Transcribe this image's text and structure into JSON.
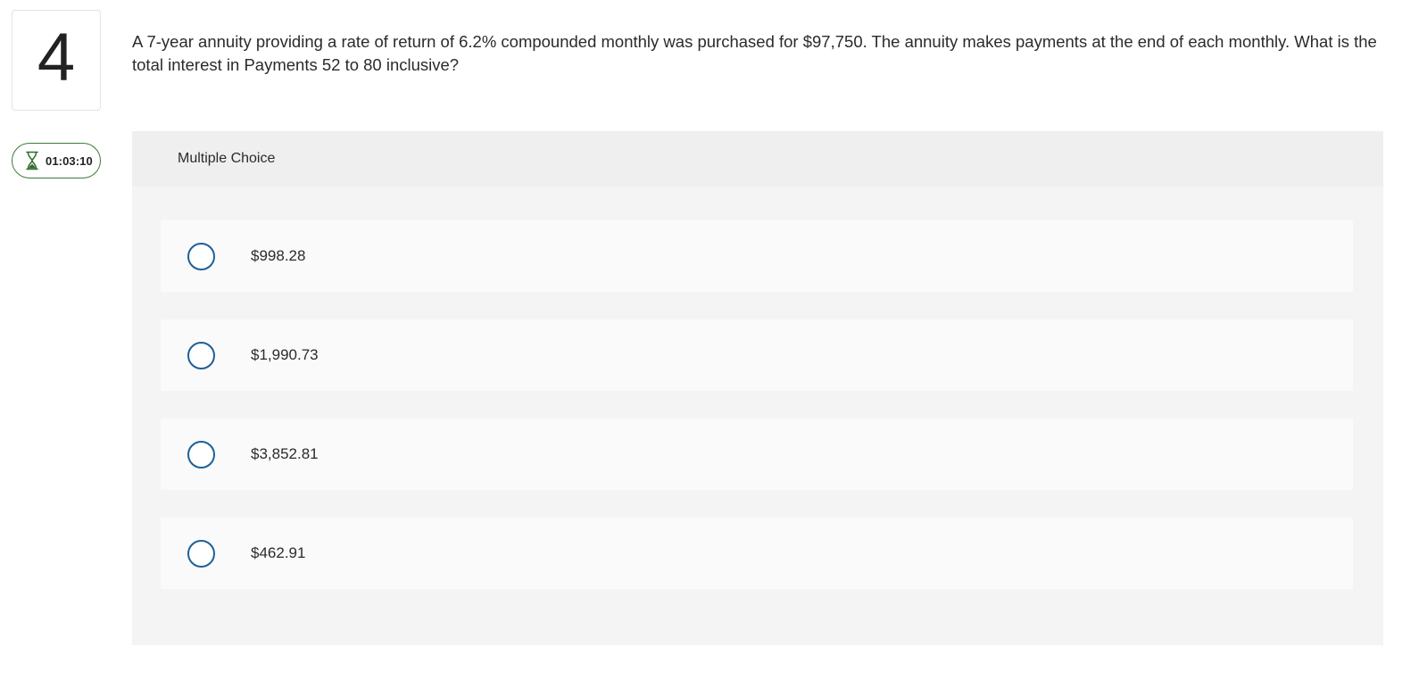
{
  "question": {
    "number": "4",
    "text": "A 7-year annuity providing a rate of return of 6.2% compounded monthly was purchased for $97,750. The annuity makes payments at the end of each monthly. What is the total interest in Payments 52 to 80 inclusive?"
  },
  "timer": {
    "icon": "hourglass-icon",
    "value": "01:03:10",
    "color": "#3d7a3a"
  },
  "answer_panel": {
    "type_label": "Multiple Choice",
    "options": [
      {
        "label": "$998.28"
      },
      {
        "label": "$1,990.73"
      },
      {
        "label": "$3,852.81"
      },
      {
        "label": "$462.91"
      }
    ]
  },
  "colors": {
    "radio_border": "#1f5f99",
    "panel_background": "#f4f4f4",
    "option_background": "#fafafa"
  }
}
